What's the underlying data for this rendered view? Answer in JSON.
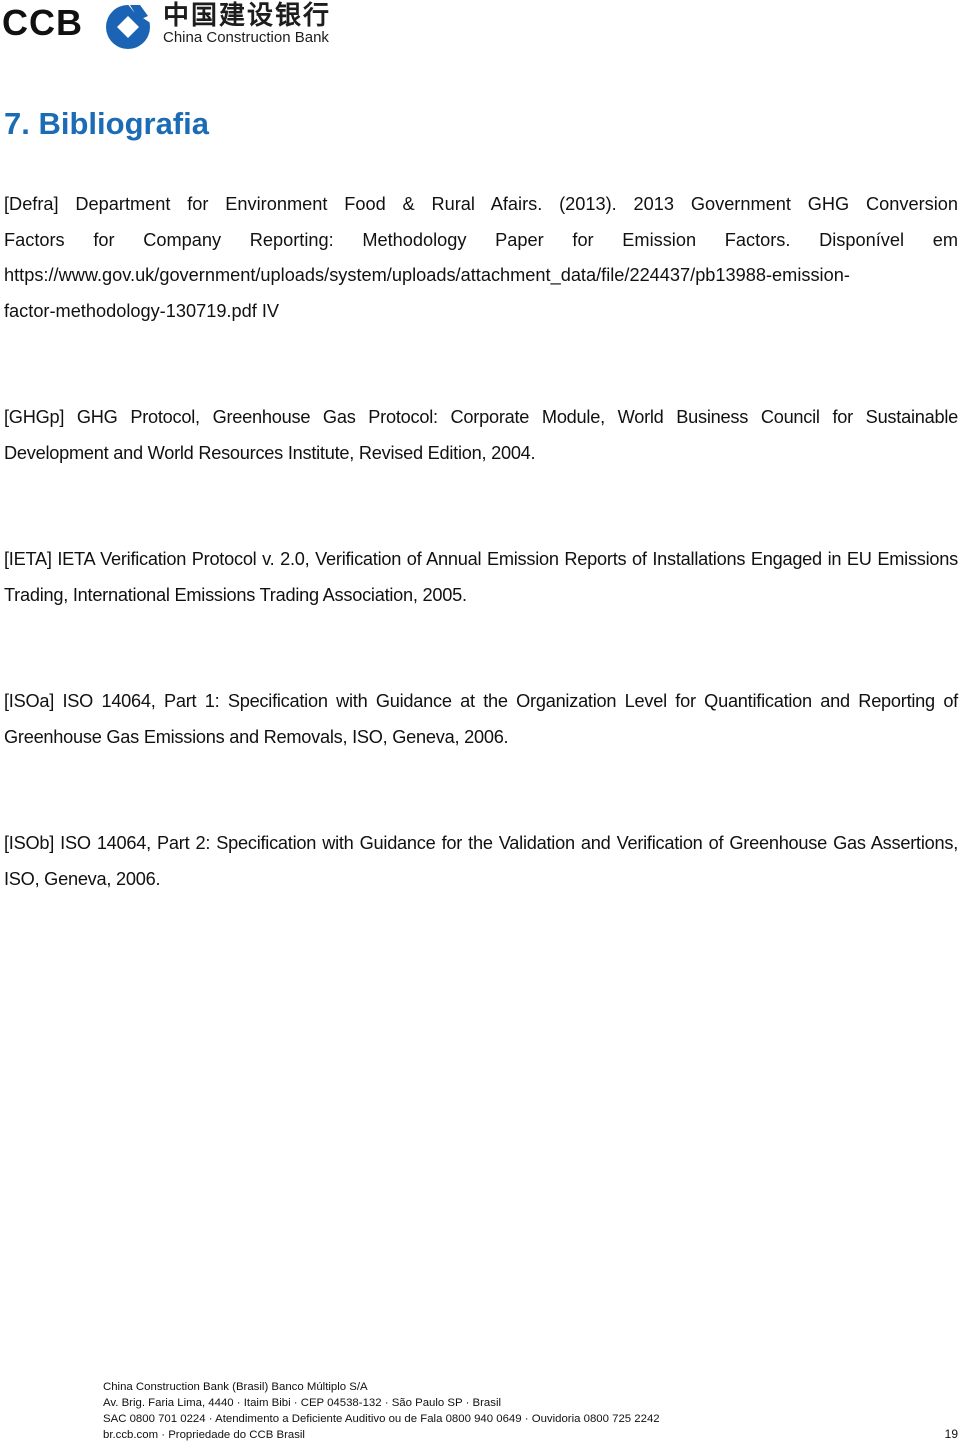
{
  "header": {
    "logo_abbrev": "CCB",
    "logo_chinese": "中国建设银行",
    "logo_english": "China Construction Bank",
    "logo_icon": "ccb-emblem-icon",
    "brand_color": "#1a63b5"
  },
  "section": {
    "title": "7. Bibliografia",
    "title_color": "#1c6cb5"
  },
  "references": [
    {
      "key": "[Defra]",
      "line1": "[Defra] Department for Environment Food & Rural Afairs. (2013). 2013 Government GHG Conversion",
      "line2": "Factors for Company Reporting: Methodology Paper for Emission Factors. Disponível em",
      "line3": "https://www.gov.uk/government/uploads/system/uploads/attachment_data/file/224437/pb13988-emission-",
      "line4": "factor-methodology-130719.pdf IV"
    },
    {
      "key": "[GHGp]",
      "text": "[GHGp] GHG Protocol, Greenhouse Gas Protocol: Corporate Module, World Business Council for Sustainable Development and World Resources Institute, Revised Edition, 2004."
    },
    {
      "key": "[IETA]",
      "text": "[IETA] IETA Verification Protocol v. 2.0, Verification of Annual Emission Reports of Installations Engaged in EU Emissions Trading, International Emissions Trading Association, 2005."
    },
    {
      "key": "[ISOa]",
      "text": "[ISOa] ISO 14064, Part 1: Specification with Guidance at the Organization Level for Quantification and Reporting of Greenhouse Gas Emissions and Removals, ISO, Geneva, 2006."
    },
    {
      "key": "[ISOb]",
      "text": "[ISOb] ISO 14064, Part 2: Specification with Guidance for the Validation and Verification of Greenhouse Gas Assertions, ISO, Geneva, 2006."
    }
  ],
  "footer": {
    "company": "China Construction Bank (Brasil) Banco Múltiplo S/A",
    "address": "Av. Brig. Faria Lima, 4440 · Itaim Bibi · CEP 04538-132 · São Paulo SP · Brasil",
    "contacts": "SAC 0800 701 0224 · Atendimento a Deficiente Auditivo ou de Fala 0800 940 0649 · Ouvidoria 0800 725 2242",
    "site": "br.ccb.com · Propriedade do CCB Brasil",
    "page_number": "19"
  }
}
